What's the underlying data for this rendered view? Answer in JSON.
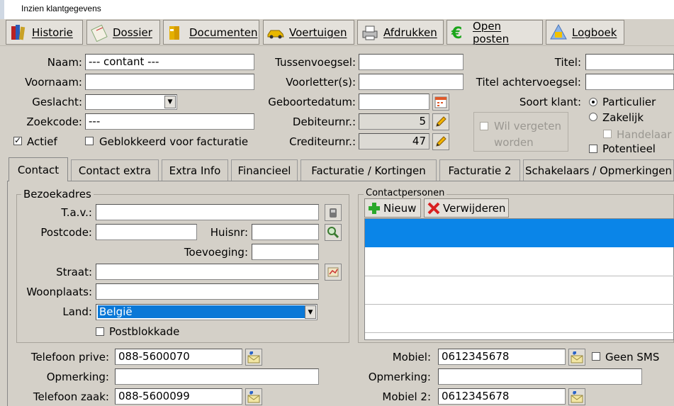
{
  "window": {
    "title": "Inzien klantgegevens"
  },
  "toolbar": [
    {
      "label": "Historie",
      "icon": "books-icon"
    },
    {
      "label": "Dossier",
      "icon": "notepad-icon"
    },
    {
      "label": "Documenten",
      "icon": "binders-icon"
    },
    {
      "label": "Voertuigen",
      "icon": "car-icon"
    },
    {
      "label": "Afdrukken",
      "icon": "printer-icon"
    },
    {
      "label": "Open posten",
      "icon": "euro-icon"
    },
    {
      "label": "Logboek",
      "icon": "logbook-icon"
    }
  ],
  "fields": {
    "naam_label": "Naam:",
    "naam_value": "--- contant ---",
    "voornaam_label": "Voornaam:",
    "voornaam_value": "",
    "geslacht_label": "Geslacht:",
    "geslacht_value": "",
    "zoekcode_label": "Zoekcode:",
    "zoekcode_value": "---",
    "actief_label": "Actief",
    "geblokkeerd_label": "Geblokkeerd voor facturatie",
    "tussenvoegsel_label": "Tussenvoegsel:",
    "tussenvoegsel_value": "",
    "voorletters_label": "Voorletter(s):",
    "voorletters_value": "",
    "geboortedatum_label": "Geboortedatum:",
    "geboortedatum_value": "",
    "debiteurnr_label": "Debiteurnr.:",
    "debiteurnr_value": "5",
    "crediteurnr_label": "Crediteurnr.:",
    "crediteurnr_value": "47",
    "titel_label": "Titel:",
    "titel_value": "",
    "titel_achter_label": "Titel achtervoegsel:",
    "titel_achter_value": "",
    "soort_label": "Soort klant:",
    "particulier_label": "Particulier",
    "zakelijk_label": "Zakelijk",
    "handelaar_label": "Handelaar",
    "potentieel_label": "Potentieel",
    "wil_vergeten_line1": "Wil vergeten",
    "wil_vergeten_line2": "worden"
  },
  "tabs": [
    "Contact",
    "Contact extra",
    "Extra Info",
    "Financieel",
    "Facturatie / Kortingen",
    "Facturatie 2",
    "Schakelaars / Opmerkingen"
  ],
  "bezoekadres": {
    "title": "Bezoekadres",
    "tav_label": "T.a.v.:",
    "tav_value": "",
    "postcode_label": "Postcode:",
    "postcode_value": "",
    "huisnr_label": "Huisnr:",
    "huisnr_value": "",
    "toevoeging_label": "Toevoeging:",
    "toevoeging_value": "",
    "straat_label": "Straat:",
    "straat_value": "",
    "woonplaats_label": "Woonplaats:",
    "woonplaats_value": "",
    "land_label": "Land:",
    "land_value": "België",
    "postblokkade_label": "Postblokkade"
  },
  "contactpersonen": {
    "title": "Contactpersonen",
    "nieuw_label": "Nieuw",
    "verwijderen_label": "Verwijderen"
  },
  "phones": {
    "tel_prive_label": "Telefoon prive:",
    "tel_prive_value": "088-5600070",
    "opmerking1_label": "Opmerking:",
    "opmerking1_value": "",
    "tel_zaak_label": "Telefoon zaak:",
    "tel_zaak_value": "088-5600099",
    "mobiel_label": "Mobiel:",
    "mobiel_value": "0612345678",
    "geen_sms_label": "Geen SMS",
    "opmerking2_label": "Opmerking:",
    "opmerking2_value": "",
    "mobiel2_label": "Mobiel 2:",
    "mobiel2_value": "0612345678"
  },
  "colors": {
    "selection": "#0a78d7",
    "list_selected": "#0a85e8",
    "background": "#d4d0c8"
  }
}
